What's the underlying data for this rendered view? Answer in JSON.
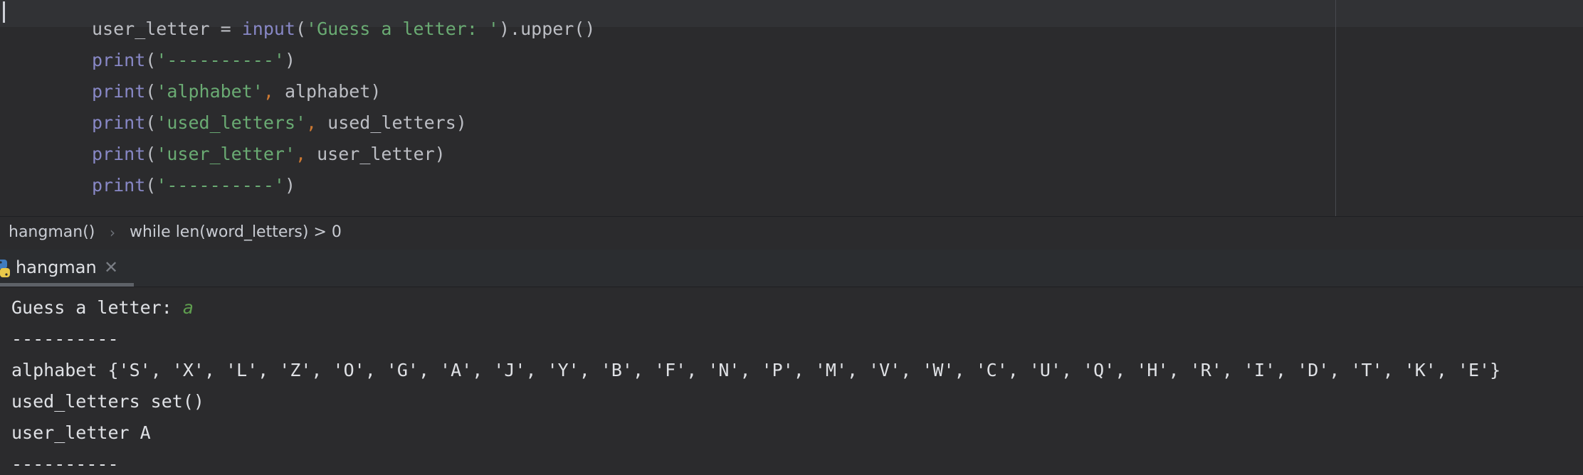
{
  "editor": {
    "lines": [
      [
        {
          "t": "user_letter = ",
          "c": "plain"
        },
        {
          "t": "input",
          "c": "builtin"
        },
        {
          "t": "(",
          "c": "plain"
        },
        {
          "t": "'Guess a letter: '",
          "c": "str"
        },
        {
          "t": ").upper()",
          "c": "plain"
        }
      ],
      [
        {
          "t": "print",
          "c": "builtin"
        },
        {
          "t": "(",
          "c": "plain"
        },
        {
          "t": "'----------'",
          "c": "str"
        },
        {
          "t": ")",
          "c": "plain"
        }
      ],
      [
        {
          "t": "print",
          "c": "builtin"
        },
        {
          "t": "(",
          "c": "plain"
        },
        {
          "t": "'alphabet'",
          "c": "str"
        },
        {
          "t": ", ",
          "c": "comma"
        },
        {
          "t": "alphabet)",
          "c": "plain"
        }
      ],
      [
        {
          "t": "print",
          "c": "builtin"
        },
        {
          "t": "(",
          "c": "plain"
        },
        {
          "t": "'used_letters'",
          "c": "str"
        },
        {
          "t": ", ",
          "c": "comma"
        },
        {
          "t": "used_letters)",
          "c": "plain"
        }
      ],
      [
        {
          "t": "print",
          "c": "builtin"
        },
        {
          "t": "(",
          "c": "plain"
        },
        {
          "t": "'user_letter'",
          "c": "str"
        },
        {
          "t": ", ",
          "c": "comma"
        },
        {
          "t": "user_letter)",
          "c": "plain"
        }
      ],
      [
        {
          "t": "print",
          "c": "builtin"
        },
        {
          "t": "(",
          "c": "plain"
        },
        {
          "t": "'----------'",
          "c": "str"
        },
        {
          "t": ")",
          "c": "plain"
        }
      ]
    ]
  },
  "breadcrumb": {
    "item1": "hangman()",
    "separator": "›",
    "item2": "while len(word_letters) > 0"
  },
  "run_tab": {
    "label": "hangman",
    "close_glyph": "✕",
    "icon": "python-icon"
  },
  "console": {
    "prompt": "Guess a letter: ",
    "input_value": "a",
    "lines": [
      "----------",
      "alphabet {'S', 'X', 'L', 'Z', 'O', 'G', 'A', 'J', 'Y', 'B', 'F', 'N', 'P', 'M', 'V', 'W', 'C', 'U', 'Q', 'H', 'R', 'I', 'D', 'T', 'K', 'E'}",
      "used_letters set()",
      "user_letter A",
      "----------"
    ]
  },
  "colors": {
    "builtin": "#8888c6",
    "string": "#6aab73",
    "comma": "#cc7832",
    "input_echo": "#5f9e4f"
  }
}
